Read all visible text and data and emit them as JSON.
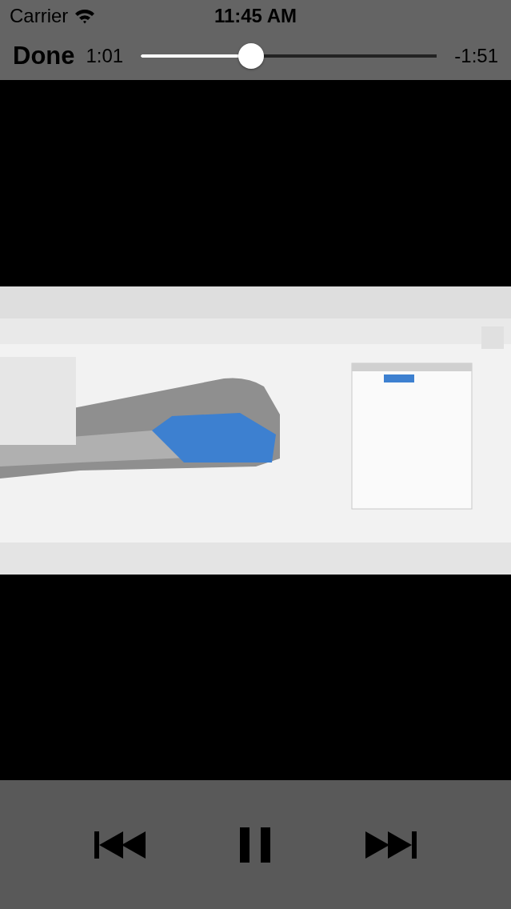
{
  "status_bar": {
    "carrier": "Carrier",
    "time": "11:45 AM"
  },
  "player_bar": {
    "done": "Done",
    "elapsed": "1:01",
    "level": 0.36,
    "remaining": "-1:51"
  },
  "controls": [
    {
      "kind": "previous"
    },
    {
      "kind": "pause"
    },
    {
      "kind": "next"
    }
  ]
}
